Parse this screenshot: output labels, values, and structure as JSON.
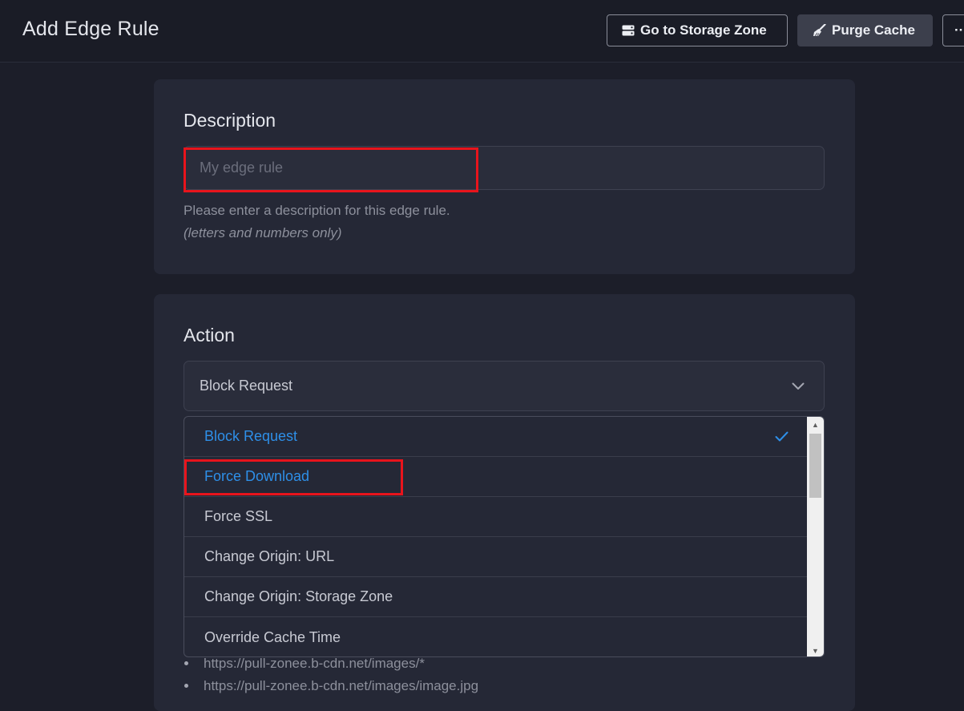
{
  "header": {
    "title": "Add Edge Rule",
    "storage_button": "Go to Storage Zone",
    "purge_button": "Purge Cache",
    "more_button": "···"
  },
  "description_section": {
    "title": "Description",
    "placeholder": "My edge rule",
    "value": "",
    "hint": "Please enter a description for this edge rule.",
    "hint_note": "(letters and numbers only)"
  },
  "action_section": {
    "title": "Action",
    "selected": "Block Request",
    "options": [
      {
        "label": "Block Request",
        "selected": true
      },
      {
        "label": "Force Download",
        "selected": false
      },
      {
        "label": "Force SSL",
        "selected": false
      },
      {
        "label": "Change Origin: URL",
        "selected": false
      },
      {
        "label": "Change Origin: Storage Zone",
        "selected": false
      },
      {
        "label": "Override Cache Time",
        "selected": false
      }
    ]
  },
  "url_examples": [
    "https://pull-zonee.b-cdn.net/images/*",
    "https://pull-zonee.b-cdn.net/images/image.jpg"
  ],
  "colors": {
    "background": "#1c1e29",
    "card": "#252836",
    "accent": "#2e8fe8",
    "highlight": "#e8141c"
  },
  "icons": {
    "storage": "storage-drive-icon",
    "purge": "broom-icon",
    "chevron": "chevron-down-icon",
    "check": "check-icon"
  }
}
